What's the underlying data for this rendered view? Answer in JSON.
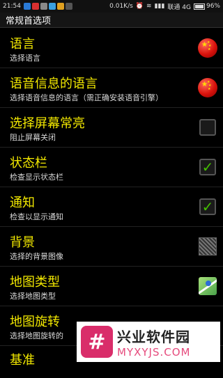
{
  "status_bar": {
    "time": "21:54",
    "speed": "0.01K/s",
    "carrier": "联通 4G",
    "battery": "96%",
    "battery_level": 0.96
  },
  "header": {
    "title": "常规首选项"
  },
  "preferences": [
    {
      "title": "语言",
      "summary": "选择语言",
      "widget": "flag-icon"
    },
    {
      "title": "语音信息的语言",
      "summary": "选择语音信息的语言（需正确安装语音引擎）",
      "widget": "flag-icon"
    },
    {
      "title": "选择屏幕常亮",
      "summary": "阻止屏幕关闭",
      "widget": "checkbox",
      "checked": false
    },
    {
      "title": "状态栏",
      "summary": "检查显示状态栏",
      "widget": "checkbox",
      "checked": true
    },
    {
      "title": "通知",
      "summary": "检查以显示通知",
      "widget": "checkbox",
      "checked": true
    },
    {
      "title": "背景",
      "summary": "选择的背景图像",
      "widget": "background-thumbnail"
    },
    {
      "title": "地图类型",
      "summary": "选择地图类型",
      "widget": "map-thumbnail"
    },
    {
      "title": "地图旋转",
      "summary": "选择地图旋转的"
    },
    {
      "title": "基准"
    }
  ],
  "watermark": {
    "name": "兴业软件园",
    "domain": "MYXYJS.COM",
    "logo_glyph": "#"
  }
}
